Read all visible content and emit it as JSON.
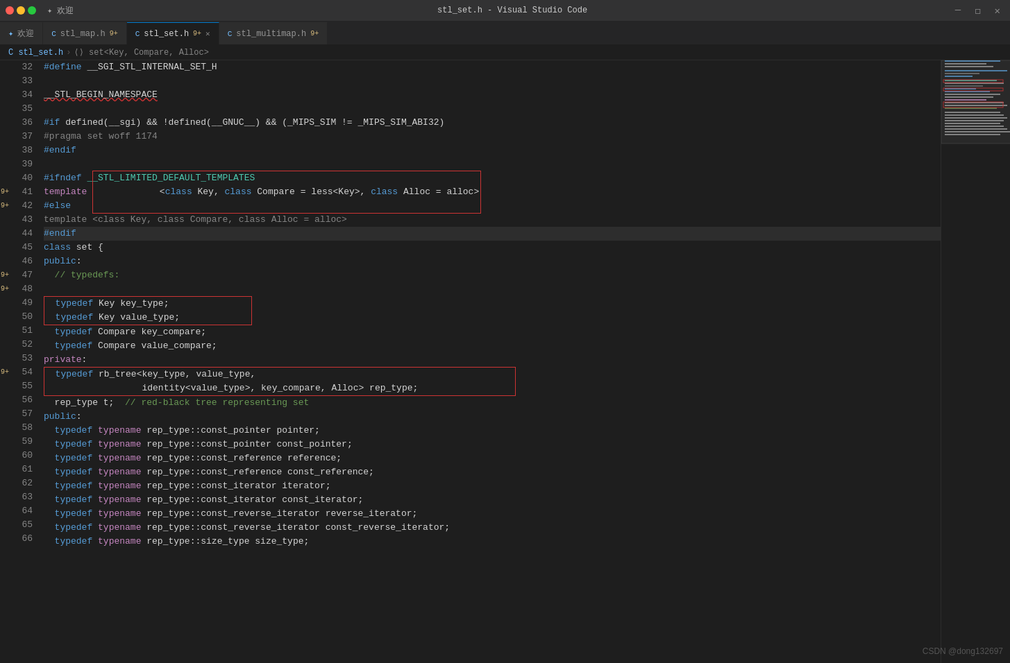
{
  "titlebar": {
    "title": "stl_set.h - Visual Studio Code",
    "controls": [
      "minimize",
      "maximize",
      "close"
    ]
  },
  "tabs": [
    {
      "id": "welcome",
      "label": "欢迎",
      "icon": "✦",
      "active": false,
      "closable": false
    },
    {
      "id": "stl_map",
      "label": "stl_map.h",
      "icon": "C",
      "badge": "9+",
      "active": false,
      "closable": false
    },
    {
      "id": "stl_set",
      "label": "stl_set.h",
      "icon": "C",
      "badge": "9+",
      "active": true,
      "closable": true
    },
    {
      "id": "stl_multimap",
      "label": "stl_multimap.h",
      "icon": "C",
      "badge": "9+",
      "active": false,
      "closable": false
    }
  ],
  "breadcrumb": {
    "parts": [
      "C  stl_set.h",
      "›",
      "⟨⟩ set<Key, Compare, Alloc>"
    ]
  },
  "annotations": {
    "lines": {
      "32": "",
      "33": "",
      "34": "",
      "35": "",
      "36": "",
      "37": "",
      "38": "",
      "39": "",
      "40": "",
      "41": "9+",
      "42": "9+",
      "43": "",
      "44": "",
      "45": "",
      "46": "",
      "47": "9+",
      "48": "9+",
      "49": "",
      "50": "",
      "51": "",
      "52": "",
      "53": "",
      "54": "9+",
      "55": "",
      "56": "",
      "57": "",
      "58": "",
      "59": "",
      "60": "",
      "61": "",
      "62": "",
      "63": "",
      "64": "",
      "65": "",
      "66": ""
    }
  },
  "code": {
    "lines": [
      {
        "num": 32,
        "content": "#define __SGI_STL_INTERNAL_SET_H",
        "type": "define"
      },
      {
        "num": 33,
        "content": "",
        "type": "empty"
      },
      {
        "num": 34,
        "content": "__STL_BEGIN_NAMESPACE",
        "type": "macro"
      },
      {
        "num": 35,
        "content": "",
        "type": "empty"
      },
      {
        "num": 36,
        "content": "#if defined(__sgi) && !defined(__GNUC__) && (_MIPS_SIM != _MIPS_SIM_ABI32)",
        "type": "ifdef"
      },
      {
        "num": 37,
        "content": "#pragma set woff 1174",
        "type": "pragma"
      },
      {
        "num": 38,
        "content": "#endif",
        "type": "define"
      },
      {
        "num": 39,
        "content": "",
        "type": "empty"
      },
      {
        "num": 40,
        "content": "#ifndef __STL_LIMITED_DEFAULT_TEMPLATES",
        "type": "define"
      },
      {
        "num": 41,
        "content": "template <class Key, class Compare = less<Key>, class Alloc = alloc>",
        "type": "template_box1"
      },
      {
        "num": 42,
        "content": "#else",
        "type": "define"
      },
      {
        "num": 43,
        "content": "template <class Key, class Compare, class Alloc = alloc>",
        "type": "template_dim"
      },
      {
        "num": 44,
        "content": "#endif",
        "type": "define_cursor"
      },
      {
        "num": 45,
        "content": "class set {",
        "type": "class"
      },
      {
        "num": 46,
        "content": "public:",
        "type": "access"
      },
      {
        "num": 47,
        "content": "  // typedefs:",
        "type": "comment"
      },
      {
        "num": 48,
        "content": "",
        "type": "empty"
      },
      {
        "num": 49,
        "content": "  typedef Key key_type;",
        "type": "typedef_box2"
      },
      {
        "num": 50,
        "content": "  typedef Key value_type;",
        "type": "typedef_box2"
      },
      {
        "num": 51,
        "content": "  typedef Compare key_compare;",
        "type": "typedef"
      },
      {
        "num": 52,
        "content": "  typedef Compare value_compare;",
        "type": "typedef"
      },
      {
        "num": 53,
        "content": "private:",
        "type": "access_private"
      },
      {
        "num": 54,
        "content": "  typedef rb_tree<key_type, value_type,",
        "type": "typedef_box3"
      },
      {
        "num": 55,
        "content": "                  identity<value_type>, key_compare, Alloc> rep_type;",
        "type": "typedef_box3_cont"
      },
      {
        "num": 56,
        "content": "  rep_type t;  // red-black tree representing set",
        "type": "reptype"
      },
      {
        "num": 57,
        "content": "public:",
        "type": "access"
      },
      {
        "num": 58,
        "content": "  typedef typename rep_type::const_pointer pointer;",
        "type": "typedef"
      },
      {
        "num": 59,
        "content": "  typedef typename rep_type::const_pointer const_pointer;",
        "type": "typedef"
      },
      {
        "num": 60,
        "content": "  typedef typename rep_type::const_reference reference;",
        "type": "typedef"
      },
      {
        "num": 61,
        "content": "  typedef typename rep_type::const_reference const_reference;",
        "type": "typedef"
      },
      {
        "num": 62,
        "content": "  typedef typename rep_type::const_iterator iterator;",
        "type": "typedef"
      },
      {
        "num": 63,
        "content": "  typedef typename rep_type::const_iterator const_iterator;",
        "type": "typedef"
      },
      {
        "num": 64,
        "content": "  typedef typename rep_type::const_reverse_iterator reverse_iterator;",
        "type": "typedef"
      },
      {
        "num": 65,
        "content": "  typedef typename rep_type::const_reverse_iterator const_reverse_iterator;",
        "type": "typedef"
      },
      {
        "num": 66,
        "content": "  typedef typename rep_type::size_type size_type;",
        "type": "typedef"
      }
    ]
  },
  "watermark": "CSDN @dong132697",
  "colors": {
    "background": "#1e1e1e",
    "tabActive": "#1e1e1e",
    "tabInactive": "#2d2d2d",
    "accent": "#007acc",
    "redBorder": "#cc3333",
    "keyword": "#c586c0",
    "type": "#4ec9b0",
    "define": "#569cd6",
    "comment": "#6a9955",
    "gutter": "#858585"
  }
}
